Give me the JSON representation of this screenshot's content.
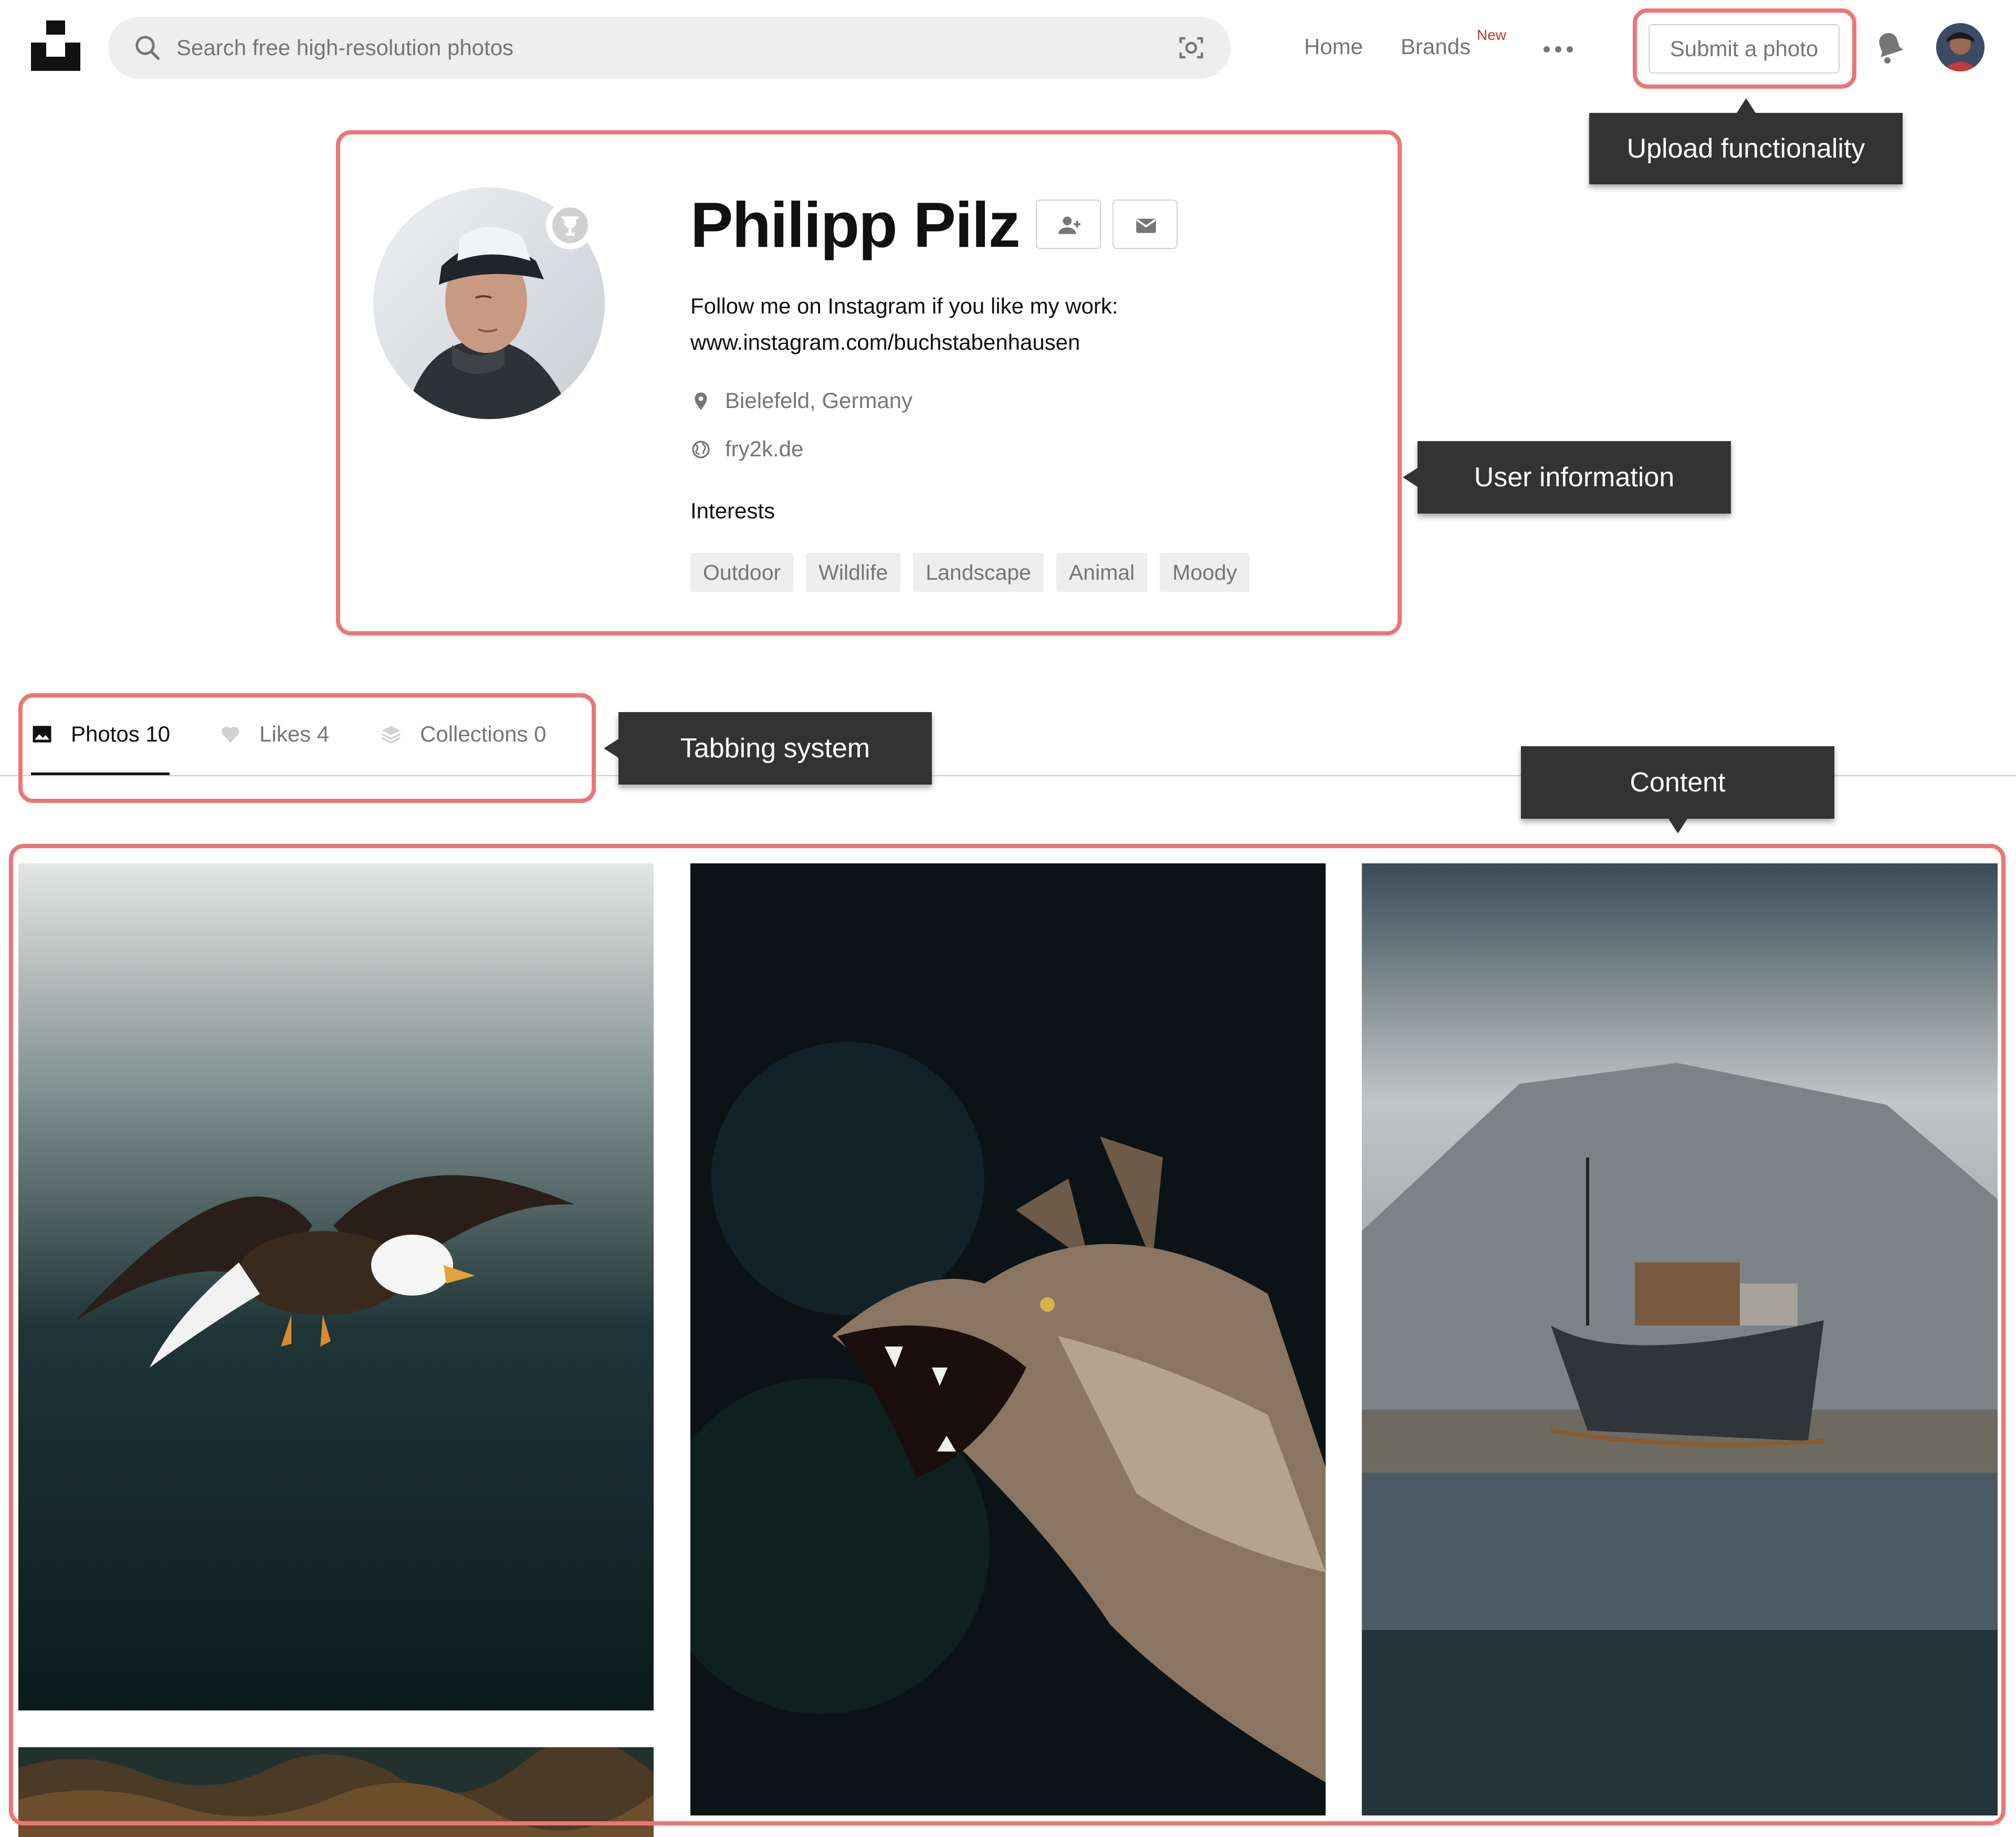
{
  "header": {
    "search_placeholder": "Search free high-resolution photos",
    "nav": [
      {
        "label": "Home"
      },
      {
        "label": "Brands",
        "badge": "New"
      }
    ],
    "submit_label": "Submit a photo",
    "icons": [
      "unsplash-logo-icon",
      "search-icon",
      "visual-search-icon",
      "more-icon",
      "notification-bell-icon"
    ]
  },
  "profile": {
    "name": "Philipp Pilz",
    "bio_line1": "Follow me on Instagram if you like my work:",
    "bio_line2": "www.instagram.com/buchstabenhausen",
    "location": "Bielefeld, Germany",
    "website": "fry2k.de",
    "interests_label": "Interests",
    "interests": [
      "Outdoor",
      "Wildlife",
      "Landscape",
      "Animal",
      "Moody"
    ]
  },
  "tabs": [
    {
      "label": "Photos 10",
      "active": true,
      "icon": "image-icon"
    },
    {
      "label": "Likes 4",
      "active": false,
      "icon": "heart-icon"
    },
    {
      "label": "Collections 0",
      "active": false,
      "icon": "collections-stack-icon"
    }
  ],
  "annotations": {
    "upload": "Upload functionality",
    "user_info": "User information",
    "tabbing": "Tabbing system",
    "content": "Content"
  },
  "colors": {
    "highlight": "#ee7575",
    "callout_bg": "#333333",
    "new_badge": "#c0392b",
    "text_primary": "#111111",
    "text_secondary": "#767676"
  }
}
